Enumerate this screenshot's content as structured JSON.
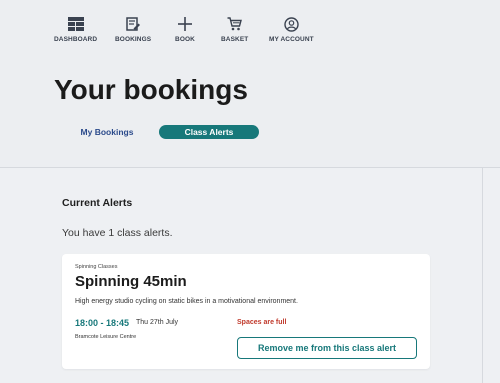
{
  "nav": {
    "items": [
      {
        "label": "DASHBOARD",
        "icon": "dashboard-icon"
      },
      {
        "label": "BOOKINGS",
        "icon": "bookings-icon"
      },
      {
        "label": "BOOK",
        "icon": "plus-icon"
      },
      {
        "label": "BASKET",
        "icon": "basket-icon"
      },
      {
        "label": "MY ACCOUNT",
        "icon": "account-icon"
      }
    ]
  },
  "page": {
    "title": "Your bookings"
  },
  "tabs": [
    {
      "label": "My Bookings",
      "active": false
    },
    {
      "label": "Class Alerts",
      "active": true
    }
  ],
  "alerts": {
    "heading": "Current Alerts",
    "count_text": "You have 1 class alerts.",
    "items": [
      {
        "category": "Spinning Classes",
        "title": "Spinning 45min",
        "description": "High energy studio cycling on static bikes in a motivational environment.",
        "time": "18:00 - 18:45",
        "date": "Thu 27th July",
        "status": "Spaces are full",
        "venue": "Bramcote Leisure Centre",
        "button_label": "Remove me from this class alert"
      }
    ]
  },
  "colors": {
    "accent": "#17787a",
    "tab_text": "#2b4a8b",
    "status_full": "#c0392b",
    "background": "#eef0f3"
  }
}
